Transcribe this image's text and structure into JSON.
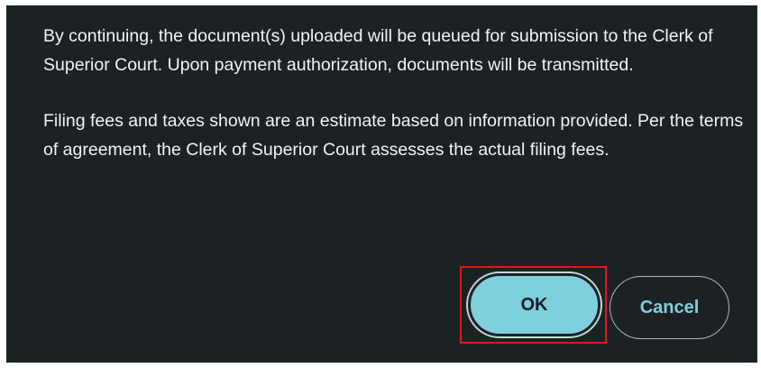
{
  "dialog": {
    "paragraphs": [
      "By continuing, the document(s) uploaded will be queued for submission to the Clerk of Superior Court. Upon payment authorization, documents will be transmitted.",
      "Filing fees and taxes shown are an estimate based on information provided. Per the terms of agreement, the Clerk of Superior Court assesses the actual filing fees."
    ],
    "buttons": {
      "ok_label": "OK",
      "cancel_label": "Cancel"
    }
  },
  "colors": {
    "dialog_background": "#1c2124",
    "text": "#f1f3f4",
    "accent": "#7fd0df",
    "highlight": "#e3151a"
  }
}
